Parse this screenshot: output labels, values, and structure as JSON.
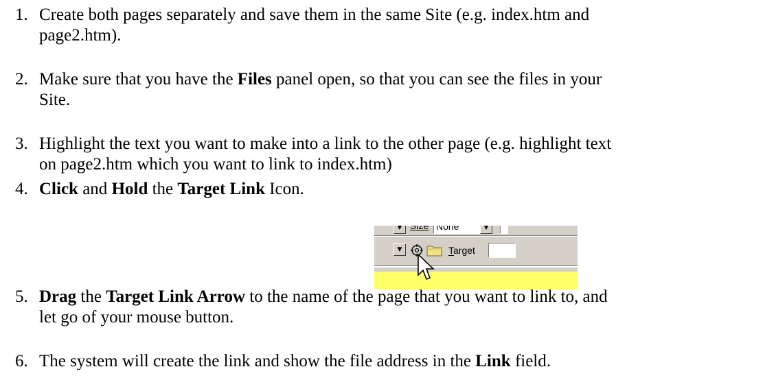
{
  "steps": [
    {
      "number": "1.",
      "lines": [
        "Create both pages separately and save them in the same Site (e.g. index.htm and",
        "page2.htm)."
      ]
    },
    {
      "number": "2.",
      "parts": {
        "a": "Make sure that you have the ",
        "b": "Files",
        "c": " panel open, so that you can see the files in your",
        "d": "Site."
      }
    },
    {
      "number": "3.",
      "lines": [
        "Highlight the text you want to make into a link to the other page (e.g. highlight text",
        "on page2.htm which you want to link to index.htm)"
      ]
    },
    {
      "number": "4.",
      "parts": {
        "a": "Click",
        "b": " and ",
        "c": "Hold",
        "d": " the ",
        "e": "Target Link",
        "f": " Icon."
      }
    },
    {
      "number": "5.",
      "parts": {
        "a": "Drag",
        "b": " the ",
        "c": "Target Link Arrow",
        "d": " to the name of the page that you want to link to, and",
        "e": "let go of your mouse button."
      }
    },
    {
      "number": "6.",
      "parts": {
        "a": "The system will create the link and show the file address in the ",
        "b": "Link",
        "c": " field."
      }
    }
  ],
  "screenshot": {
    "size_label": "Size",
    "size_value": "None",
    "target_label": "Target",
    "icon": "target-link-icon",
    "folder_icon": "folder-icon",
    "cursor_icon": "arrow-cursor-icon",
    "panel_color": "#d4d0c8",
    "highlight_color": "#ffff66"
  }
}
